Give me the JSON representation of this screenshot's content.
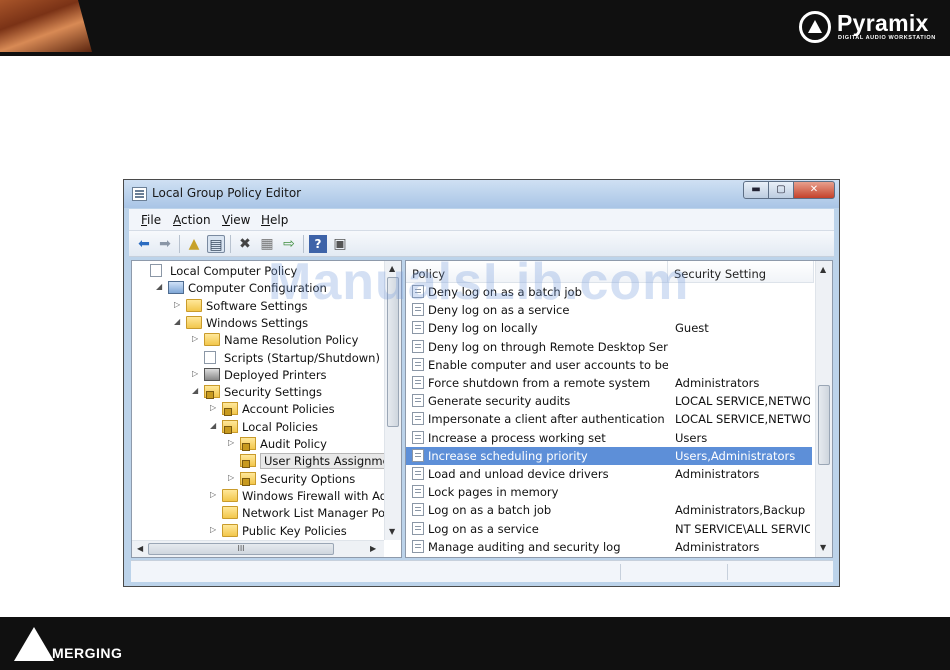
{
  "branding": {
    "product_name": "Pyramix",
    "product_tagline": "DIGITAL AUDIO WORKSTATION",
    "company_name": "MERGING"
  },
  "watermark": "ManualsLib.com",
  "window": {
    "title": "Local Group Policy Editor",
    "buttons": {
      "minimize": "▬",
      "maximize": "▢",
      "close": "✕"
    }
  },
  "menu": [
    {
      "label": "File",
      "accel": "F",
      "rest": "ile"
    },
    {
      "label": "Action",
      "accel": "A",
      "rest": "ction"
    },
    {
      "label": "View",
      "accel": "V",
      "rest": "iew"
    },
    {
      "label": "Help",
      "accel": "H",
      "rest": "elp"
    }
  ],
  "toolbar": {
    "back": "back-arrow-icon",
    "forward": "forward-arrow-icon",
    "up": "up-folder-icon",
    "show_hide_tree": "console-tree-icon",
    "delete": "delete-icon",
    "properties": "properties-icon",
    "export": "export-list-icon",
    "help": "help-icon",
    "extended_view": "extended-view-icon"
  },
  "tree": [
    {
      "label": "Local Computer Policy",
      "depth": 0,
      "arrow": "",
      "icon": "doc"
    },
    {
      "label": "Computer Configuration",
      "depth": 1,
      "arrow": "◢",
      "icon": "computer"
    },
    {
      "label": "Software Settings",
      "depth": 2,
      "arrow": "▷",
      "icon": "folder"
    },
    {
      "label": "Windows Settings",
      "depth": 2,
      "arrow": "◢",
      "icon": "folder"
    },
    {
      "label": "Name Resolution Policy",
      "depth": 3,
      "arrow": "▷",
      "icon": "folder"
    },
    {
      "label": "Scripts (Startup/Shutdown)",
      "depth": 3,
      "arrow": "",
      "icon": "doc"
    },
    {
      "label": "Deployed Printers",
      "depth": 3,
      "arrow": "▷",
      "icon": "printer"
    },
    {
      "label": "Security Settings",
      "depth": 3,
      "arrow": "◢",
      "icon": "folder-lock"
    },
    {
      "label": "Account Policies",
      "depth": 4,
      "arrow": "▷",
      "icon": "folder-lock"
    },
    {
      "label": "Local Policies",
      "depth": 4,
      "arrow": "◢",
      "icon": "folder-lock"
    },
    {
      "label": "Audit Policy",
      "depth": 5,
      "arrow": "▷",
      "icon": "folder-lock"
    },
    {
      "label": "User Rights Assignment",
      "depth": 5,
      "arrow": "",
      "icon": "folder-lock",
      "selected": true
    },
    {
      "label": "Security Options",
      "depth": 5,
      "arrow": "▷",
      "icon": "folder-lock"
    },
    {
      "label": "Windows Firewall with Advanc",
      "depth": 4,
      "arrow": "▷",
      "icon": "folder"
    },
    {
      "label": "Network List Manager Policies",
      "depth": 4,
      "arrow": "",
      "icon": "folder"
    },
    {
      "label": "Public Key Policies",
      "depth": 4,
      "arrow": "▷",
      "icon": "folder"
    }
  ],
  "tree_hscroll_grip": "III",
  "list": {
    "columns": [
      "Policy",
      "Security Setting"
    ],
    "rows": [
      {
        "policy": "Deny log on as a batch job",
        "setting": ""
      },
      {
        "policy": "Deny log on as a service",
        "setting": ""
      },
      {
        "policy": "Deny log on locally",
        "setting": "Guest"
      },
      {
        "policy": "Deny log on through Remote Desktop Services",
        "setting": ""
      },
      {
        "policy": "Enable computer and user accounts to be tru...",
        "setting": ""
      },
      {
        "policy": "Force shutdown from a remote system",
        "setting": "Administrators"
      },
      {
        "policy": "Generate security audits",
        "setting": "LOCAL SERVICE,NETWO..."
      },
      {
        "policy": "Impersonate a client after authentication",
        "setting": "LOCAL SERVICE,NETWO..."
      },
      {
        "policy": "Increase a process working set",
        "setting": "Users"
      },
      {
        "policy": "Increase scheduling priority",
        "setting": "Users,Administrators",
        "selected": true
      },
      {
        "policy": "Load and unload device drivers",
        "setting": "Administrators"
      },
      {
        "policy": "Lock pages in memory",
        "setting": ""
      },
      {
        "policy": "Log on as a batch job",
        "setting": "Administrators,Backup ..."
      },
      {
        "policy": "Log on as a service",
        "setting": "NT SERVICE\\ALL SERVIC..."
      },
      {
        "policy": "Manage auditing and security log",
        "setting": "Administrators"
      }
    ]
  },
  "colors": {
    "selection": "#5d8fd8",
    "titlebar": "#bcd3ea",
    "close_button": "#c4412a"
  }
}
